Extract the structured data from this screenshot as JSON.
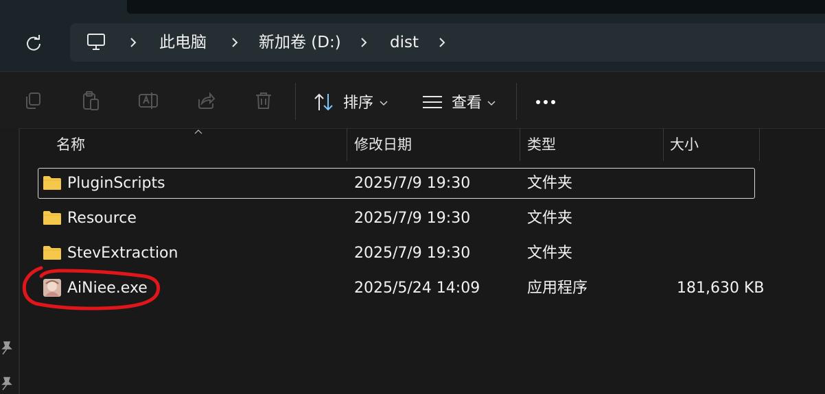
{
  "address_bar": {
    "crumbs": [
      "此电脑",
      "新加卷 (D:)",
      "dist"
    ]
  },
  "toolbar": {
    "sort_label": "排序",
    "view_label": "查看"
  },
  "columns": {
    "name": "名称",
    "date": "修改日期",
    "type": "类型",
    "size": "大小"
  },
  "files": [
    {
      "name": "PluginScripts",
      "date": "2025/7/9 19:30",
      "type": "文件夹",
      "size": "",
      "icon": "folder-icon",
      "selected": true
    },
    {
      "name": "Resource",
      "date": "2025/7/9 19:30",
      "type": "文件夹",
      "size": "",
      "icon": "folder-icon",
      "selected": false
    },
    {
      "name": "StevExtraction",
      "date": "2025/7/9 19:30",
      "type": "文件夹",
      "size": "",
      "icon": "folder-icon",
      "selected": false
    },
    {
      "name": "AiNiee.exe",
      "date": "2025/5/24 14:09",
      "type": "应用程序",
      "size": "181,630 KB",
      "icon": "app-icon",
      "selected": false
    }
  ],
  "colors": {
    "background": "#191919",
    "folder": "#f5c84c",
    "annotation": "#e0161b"
  }
}
